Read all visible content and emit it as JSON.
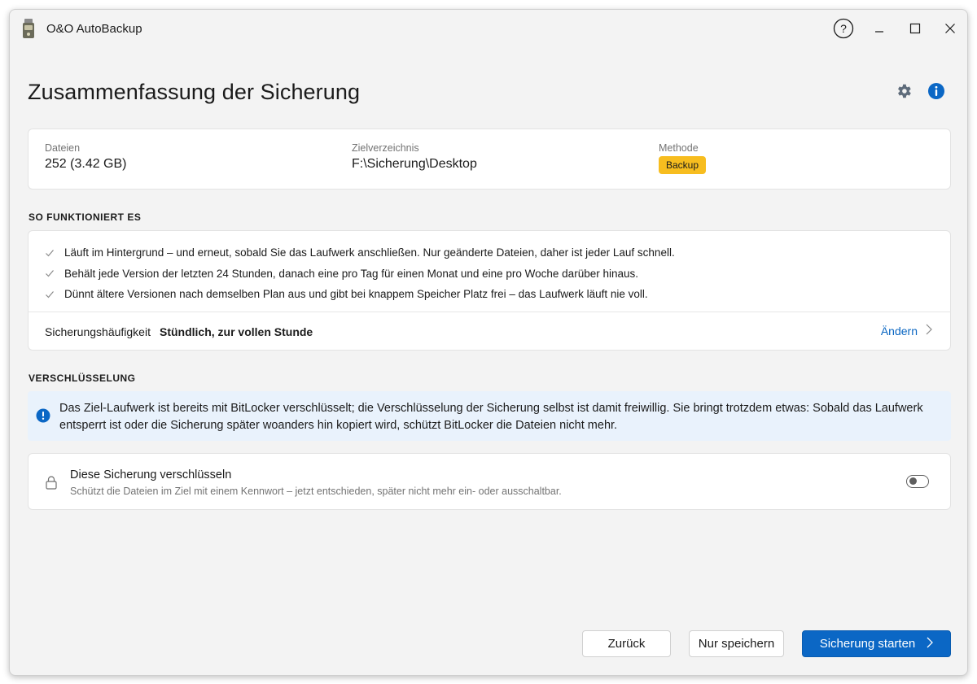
{
  "window": {
    "app_title": "O&O AutoBackup"
  },
  "header": {
    "title": "Zusammenfassung der Sicherung"
  },
  "summary": {
    "files_label": "Dateien",
    "files_value": "252 (3.42 GB)",
    "target_label": "Zielverzeichnis",
    "target_value": "F:\\Sicherung\\Desktop",
    "method_label": "Methode",
    "method_value": "Backup"
  },
  "how_it_works": {
    "heading": "SO FUNKTIONIERT ES",
    "items": [
      "Läuft im Hintergrund – und erneut, sobald Sie das Laufwerk anschließen. Nur geänderte Dateien, daher ist jeder Lauf schnell.",
      "Behält jede Version der letzten 24 Stunden, danach eine pro Tag für einen Monat und eine pro Woche darüber hinaus.",
      "Dünnt ältere Versionen nach demselben Plan aus und gibt bei knappem Speicher Platz frei – das Laufwerk läuft nie voll."
    ],
    "frequency_label": "Sicherungshäufigkeit",
    "frequency_value": "Stündlich, zur vollen Stunde",
    "change_label": "Ändern"
  },
  "encryption": {
    "heading": "VERSCHLÜSSELUNG",
    "info_text": "Das Ziel-Laufwerk ist bereits mit BitLocker verschlüsselt; die Verschlüsselung der Sicherung selbst ist damit freiwillig. Sie bringt trotzdem etwas: Sobald das Laufwerk entsperrt ist oder die Sicherung später woanders hin kopiert wird, schützt BitLocker die Dateien nicht mehr.",
    "option_title": "Diese Sicherung verschlüsseln",
    "option_subtitle": "Schützt die Dateien im Ziel mit einem Kennwort – jetzt entschieden, später nicht mehr ein- oder ausschaltbar.",
    "toggle_on": false
  },
  "footer": {
    "back_label": "Zurück",
    "save_only_label": "Nur speichern",
    "start_label": "Sicherung starten"
  },
  "colors": {
    "accent": "#0b67c5",
    "badge": "#f7bd1f",
    "info_banner": "#e9f2fc"
  }
}
